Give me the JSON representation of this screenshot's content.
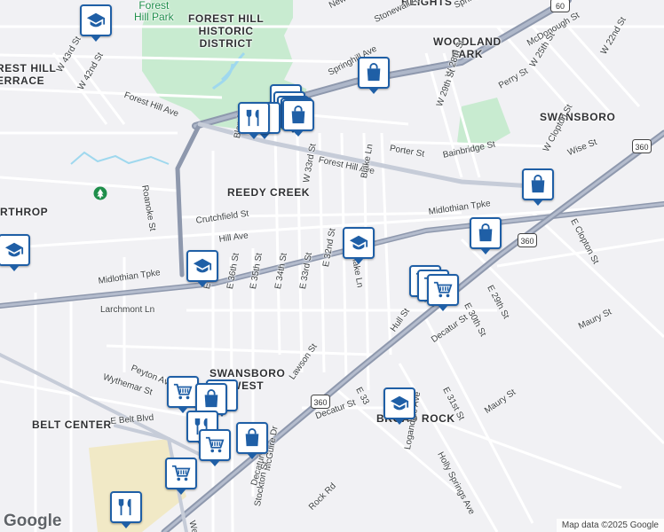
{
  "map": {
    "attribution": "Map data ©2025 Google",
    "logo": "Google",
    "colors": {
      "marker_border": "#1f5fa6",
      "marker_icon": "#1f5fa6",
      "park": "#c8ebd0",
      "major_road": "#8e98ad"
    }
  },
  "areas": [
    {
      "text": "FOREST HILL\nHISTORIC\nDISTRICT"
    },
    {
      "text": "HEIGHTS"
    },
    {
      "text": "WOODLAND\nPARK"
    },
    {
      "text": "SWANSBORO"
    },
    {
      "text": "REST HILL\nERRACE"
    },
    {
      "text": "REEDY CREEK"
    },
    {
      "text": "RTHROP"
    },
    {
      "text": "SWANSBORO\nWEST"
    },
    {
      "text": "BELT CENTER"
    },
    {
      "text": "BROAD ROCK"
    }
  ],
  "parks": [
    {
      "text": "Forest\nHill Park"
    }
  ],
  "streets": [
    "New Kent Ave",
    "Springhill Ave",
    "Stonewall Ave",
    "McDonough St",
    "W 22nd St",
    "W 25th St",
    "Springhill Ave",
    "W 28th St",
    "W 29th St",
    "Perry St",
    "W 43rd St",
    "W 42nd St",
    "Forest Hill Ave",
    "Porter St",
    "W Clopton St",
    "Wise St",
    "Bainbridge St",
    "Forest Hill Ave",
    "Bland St",
    "Roanoke St",
    "W 33rd St",
    "Blake Ln",
    "Crutchfield St",
    "Midlothian Tpke",
    "E Clopton St",
    "E 37th St",
    "E 36th St",
    "E 35th St",
    "E 34th St",
    "E 33rd St",
    "E 32nd St",
    "Blake Ln",
    "Midlothian Tpke",
    "Larchmont Ln",
    "E 29th St",
    "E 30th St",
    "Hull St",
    "Maury St",
    "Decatur St",
    "Peyton Ave",
    "Wythemar St",
    "Lawson St",
    "E 31st St",
    "Maury St",
    "Decatur St",
    "E 33",
    "E Belt Blvd",
    "Logandale Ave",
    "Holly Springs Ave",
    "McGuire Dr",
    "Decatur St",
    "Stockton St",
    "Rock Rd",
    "Welt",
    "Hill Ave",
    "Ave",
    "Wei",
    "nd St",
    "d St",
    "ake Ln",
    "on St",
    "E 2",
    "E 3",
    "Ma",
    "W 2",
    "Springh"
  ],
  "highways": [
    "60",
    "360",
    "360",
    "360"
  ],
  "markers": [
    {
      "type": "school",
      "name": "school-marker"
    },
    {
      "type": "shopping",
      "name": "shopping-marker"
    },
    {
      "type": "school",
      "name": "school-marker"
    },
    {
      "type": "shopping",
      "name": "shopping-marker"
    },
    {
      "type": "school",
      "name": "school-marker"
    },
    {
      "type": "shopping",
      "name": "shopping-marker"
    },
    {
      "type": "restaurant",
      "name": "restaurant-marker"
    },
    {
      "type": "shopping",
      "name": "shopping-marker"
    },
    {
      "type": "restaurant",
      "name": "restaurant-marker"
    },
    {
      "type": "school",
      "name": "school-marker"
    },
    {
      "type": "shopping",
      "name": "shopping-marker"
    },
    {
      "type": "school",
      "name": "school-marker"
    },
    {
      "type": "school",
      "name": "school-marker"
    },
    {
      "type": "grocery",
      "name": "grocery-marker"
    },
    {
      "type": "grocery",
      "name": "grocery-marker"
    },
    {
      "type": "grocery",
      "name": "grocery-marker"
    },
    {
      "type": "shopping",
      "name": "shopping-marker"
    },
    {
      "type": "school",
      "name": "school-marker"
    },
    {
      "type": "grocery",
      "name": "grocery-marker"
    },
    {
      "type": "restaurant",
      "name": "restaurant-marker"
    },
    {
      "type": "shopping",
      "name": "shopping-marker"
    },
    {
      "type": "restaurant",
      "name": "restaurant-marker"
    },
    {
      "type": "shopping",
      "name": "shopping-marker"
    },
    {
      "type": "grocery",
      "name": "grocery-marker"
    },
    {
      "type": "grocery",
      "name": "grocery-marker"
    },
    {
      "type": "restaurant",
      "name": "restaurant-marker"
    }
  ]
}
